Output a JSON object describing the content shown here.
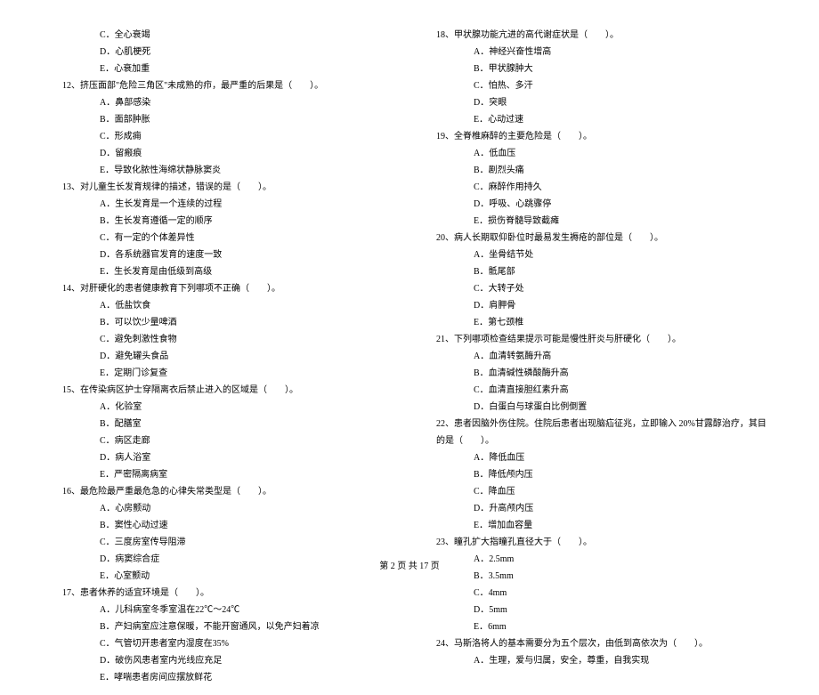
{
  "leftCol": {
    "preOptions": [
      "C．全心衰竭",
      "D．心肌梗死",
      "E．心衰加重"
    ],
    "questions": [
      {
        "num": "12、",
        "stem": "挤压面部\"危险三角区\"未成熟的疖，最严重的后果是（　　）。",
        "opts": [
          "A．鼻部感染",
          "B．面部肿胀",
          "C．形成痈",
          "D．留瘢痕",
          "E．导致化脓性海绵状静脉窦炎"
        ]
      },
      {
        "num": "13、",
        "stem": "对儿童生长发育规律的描述，错误的是（　　）。",
        "opts": [
          "A．生长发育是一个连续的过程",
          "B．生长发育遵循一定的顺序",
          "C．有一定的个体差异性",
          "D．各系统器官发育的速度一致",
          "E．生长发育是由低级到高级"
        ]
      },
      {
        "num": "14、",
        "stem": "对肝硬化的患者健康教育下列哪项不正确（　　）。",
        "opts": [
          "A．低盐饮食",
          "B．可以饮少量啤酒",
          "C．避免刺激性食物",
          "D．避免罐头食品",
          "E．定期门诊复查"
        ]
      },
      {
        "num": "15、",
        "stem": "在传染病区护士穿隔离衣后禁止进入的区域是（　　）。",
        "opts": [
          "A．化验室",
          "B．配膳室",
          "C．病区走廊",
          "D．病人浴室",
          "E．严密隔离病室"
        ]
      },
      {
        "num": "16、",
        "stem": "最危险最严重最危急的心律失常类型是（　　）。",
        "opts": [
          "A．心房颤动",
          "B．窦性心动过速",
          "C．三度房室传导阻滞",
          "D．病窦综合症",
          "E．心室颤动"
        ]
      },
      {
        "num": "17、",
        "stem": "患者休养的适宜环境是（　　）。",
        "opts": [
          "A．儿科病室冬季室温在22℃～24℃",
          "B．产妇病室应注意保暖，不能开窗通风，以免产妇着凉",
          "C．气管切开患者室内湿度在35%",
          "D．破伤风患者室内光线应充足",
          "E．哮喘患者房间应摆放鲜花"
        ]
      }
    ]
  },
  "rightCol": {
    "questions": [
      {
        "num": "18、",
        "stem": "甲状腺功能亢进的高代谢症状是（　　）。",
        "opts": [
          "A．神经兴奋性增高",
          "B．甲状腺肿大",
          "C．怕热、多汗",
          "D．突眼",
          "E．心动过速"
        ]
      },
      {
        "num": "19、",
        "stem": "全脊椎麻醉的主要危险是（　　）。",
        "opts": [
          "A．低血压",
          "B．剧烈头痛",
          "C．麻醉作用持久",
          "D．呼吸、心跳骤停",
          "E．损伤脊髓导致截瘫"
        ]
      },
      {
        "num": "20、",
        "stem": "病人长期取仰卧位时最易发生褥疮的部位是（　　）。",
        "opts": [
          "A．坐骨结节处",
          "B．骶尾部",
          "C．大转子处",
          "D．肩胛骨",
          "E．第七颈椎"
        ]
      },
      {
        "num": "21、",
        "stem": "下列哪项检查结果提示可能是慢性肝炎与肝硬化（　　）。",
        "opts": [
          "A．血清转氨酶升高",
          "B．血清碱性磷酸酶升高",
          "C．血清直接胆红素升高",
          "D．白蛋白与球蛋白比例倒置"
        ]
      },
      {
        "num": "22、",
        "stem": "患者因脑外伤住院。住院后患者出现脑疝征兆，立即输入 20%甘露醇治疗，其目的是（　　）。",
        "opts": [
          "A．降低血压",
          "B．降低颅内压",
          "C．降血压",
          "D．升高颅内压",
          "E．增加血容量"
        ]
      },
      {
        "num": "23、",
        "stem": "瞳孔扩大指瞳孔直径大于（　　）。",
        "opts": [
          "A．2.5mm",
          "B．3.5mm",
          "C．4mm",
          "D．5mm",
          "E．6mm"
        ]
      },
      {
        "num": "24、",
        "stem": "马斯洛将人的基本需要分为五个层次，由低到高依次为（　　）。",
        "opts": [
          "A．生理，爱与归属，安全，尊重，自我实现"
        ]
      }
    ]
  },
  "footer": "第 2 页 共 17 页"
}
